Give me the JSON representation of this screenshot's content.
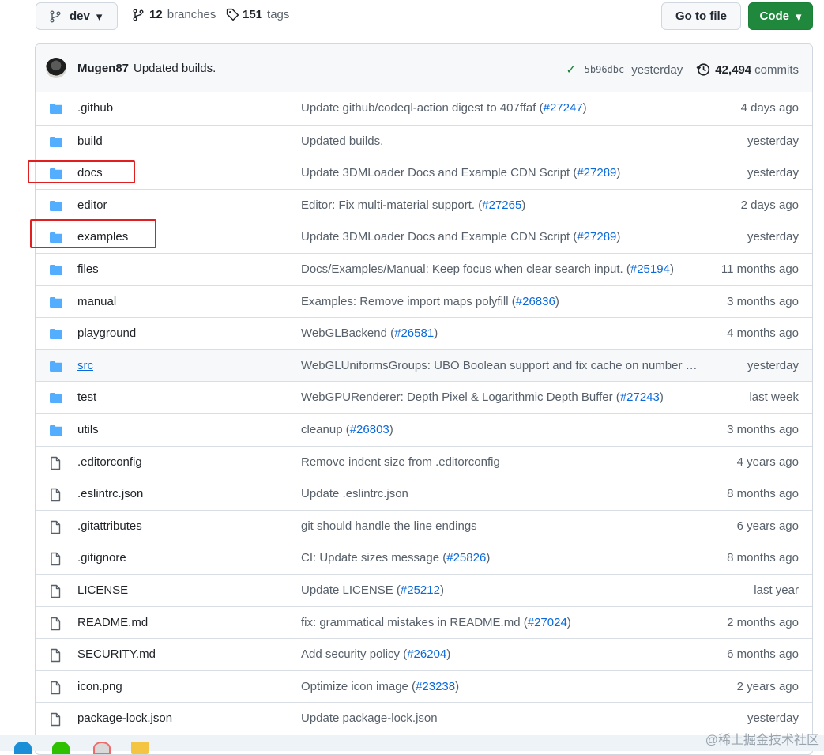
{
  "toolbar": {
    "branch_label": "dev",
    "branches_count": "12",
    "branches_label": "branches",
    "tags_count": "151",
    "tags_label": "tags",
    "goto_label": "Go to file",
    "code_label": "Code"
  },
  "latest_commit": {
    "author": "Mugen87",
    "message": "Updated builds.",
    "sha": "5b96dbc",
    "time": "yesterday",
    "commits_count": "42,494",
    "commits_label": "commits"
  },
  "files": [
    {
      "type": "dir",
      "name": ".github",
      "msg": "Update github/codeql-action digest to 407ffaf (",
      "pr": "#27247",
      "msg_end": ")",
      "age": "4 days ago"
    },
    {
      "type": "dir",
      "name": "build",
      "msg": "Updated builds.",
      "pr": "",
      "msg_end": "",
      "age": "yesterday"
    },
    {
      "type": "dir",
      "name": "docs",
      "msg": "Update 3DMLoader Docs and Example CDN Script (",
      "pr": "#27289",
      "msg_end": ")",
      "age": "yesterday"
    },
    {
      "type": "dir",
      "name": "editor",
      "msg": "Editor: Fix multi-material support. (",
      "pr": "#27265",
      "msg_end": ")",
      "age": "2 days ago"
    },
    {
      "type": "dir",
      "name": "examples",
      "msg": "Update 3DMLoader Docs and Example CDN Script (",
      "pr": "#27289",
      "msg_end": ")",
      "age": "yesterday"
    },
    {
      "type": "dir",
      "name": "files",
      "msg": "Docs/Examples/Manual: Keep focus when clear search input. (",
      "pr": "#25194",
      "msg_end": ")",
      "age": "11 months ago"
    },
    {
      "type": "dir",
      "name": "manual",
      "msg": "Examples: Remove import maps polyfill (",
      "pr": "#26836",
      "msg_end": ")",
      "age": "3 months ago"
    },
    {
      "type": "dir",
      "name": "playground",
      "msg": "WebGLBackend (",
      "pr": "#26581",
      "msg_end": ")",
      "age": "4 months ago"
    },
    {
      "type": "dir",
      "name": "src",
      "msg": "WebGLUniformsGroups: UBO Boolean support and fix cache on number …",
      "pr": "",
      "msg_end": "",
      "age": "yesterday"
    },
    {
      "type": "dir",
      "name": "test",
      "msg": "WebGPURenderer: Depth Pixel & Logarithmic Depth Buffer (",
      "pr": "#27243",
      "msg_end": ")",
      "age": "last week"
    },
    {
      "type": "dir",
      "name": "utils",
      "msg": "cleanup (",
      "pr": "#26803",
      "msg_end": ")",
      "age": "3 months ago"
    },
    {
      "type": "file",
      "name": ".editorconfig",
      "msg": "Remove indent size from .editorconfig",
      "pr": "",
      "msg_end": "",
      "age": "4 years ago"
    },
    {
      "type": "file",
      "name": ".eslintrc.json",
      "msg": "Update .eslintrc.json",
      "pr": "",
      "msg_end": "",
      "age": "8 months ago"
    },
    {
      "type": "file",
      "name": ".gitattributes",
      "msg": "git should handle the line endings",
      "pr": "",
      "msg_end": "",
      "age": "6 years ago"
    },
    {
      "type": "file",
      "name": ".gitignore",
      "msg": "CI: Update sizes message (",
      "pr": "#25826",
      "msg_end": ")",
      "age": "8 months ago"
    },
    {
      "type": "file",
      "name": "LICENSE",
      "msg": "Update LICENSE (",
      "pr": "#25212",
      "msg_end": ")",
      "age": "last year"
    },
    {
      "type": "file",
      "name": "README.md",
      "msg": "fix: grammatical mistakes in README.md (",
      "pr": "#27024",
      "msg_end": ")",
      "age": "2 months ago"
    },
    {
      "type": "file",
      "name": "SECURITY.md",
      "msg": "Add security policy (",
      "pr": "#26204",
      "msg_end": ")",
      "age": "6 months ago"
    },
    {
      "type": "file",
      "name": "icon.png",
      "msg": "Optimize icon image (",
      "pr": "#23238",
      "msg_end": ")",
      "age": "2 years ago"
    },
    {
      "type": "file",
      "name": "package-lock.json",
      "msg": "Update package-lock.json",
      "pr": "",
      "msg_end": "",
      "age": "yesterday"
    }
  ],
  "watermark": "@稀土掘金技术社区",
  "colors": {
    "folder": "#54aeff",
    "file": "#57606a",
    "link": "#0969da",
    "annotation": "#e02020",
    "code_button": "#1f883d"
  }
}
